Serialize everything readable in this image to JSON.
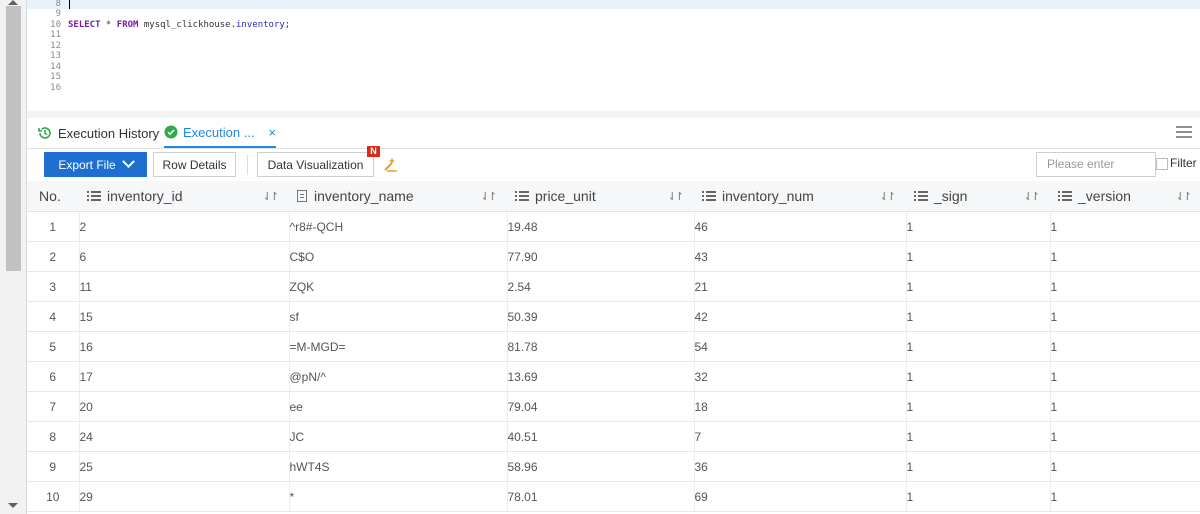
{
  "editor": {
    "lines": [
      {
        "n": "8",
        "code": ""
      },
      {
        "n": "9",
        "code": ""
      },
      {
        "n": "10",
        "kw1": "SELECT",
        "p1": " * ",
        "kw2": "FROM",
        "p2": " mysql_clickhouse.",
        "id": "inventory",
        "p3": ";"
      },
      {
        "n": "11"
      },
      {
        "n": "12"
      },
      {
        "n": "13"
      },
      {
        "n": "14"
      },
      {
        "n": "15"
      },
      {
        "n": "16"
      }
    ]
  },
  "tabs": {
    "history": "Execution History",
    "execution": "Execution ...",
    "close": "×"
  },
  "toolbar": {
    "export": "Export File",
    "row_details": "Row Details",
    "data_viz": "Data Visualization",
    "badge": "N",
    "search_placeholder": "Please enter",
    "filter": "Filter"
  },
  "table": {
    "headers": [
      "No.",
      "inventory_id",
      "inventory_name",
      "price_unit",
      "inventory_num",
      "_sign",
      "_version"
    ],
    "rows": [
      [
        "1",
        "2",
        "^r8#-QCH",
        "19.48",
        "46",
        "1",
        "1"
      ],
      [
        "2",
        "6",
        "C$O",
        "77.90",
        "43",
        "1",
        "1"
      ],
      [
        "3",
        "11",
        "ZQK",
        "2.54",
        "21",
        "1",
        "1"
      ],
      [
        "4",
        "15",
        "sf",
        "50.39",
        "42",
        "1",
        "1"
      ],
      [
        "5",
        "16",
        "=M-MGD=",
        "81.78",
        "54",
        "1",
        "1"
      ],
      [
        "6",
        "17",
        "@pN/^",
        "13.69",
        "32",
        "1",
        "1"
      ],
      [
        "7",
        "20",
        "ee",
        "79.04",
        "18",
        "1",
        "1"
      ],
      [
        "8",
        "24",
        "JC",
        "40.51",
        "7",
        "1",
        "1"
      ],
      [
        "9",
        "25",
        "hWT4S",
        "58.96",
        "36",
        "1",
        "1"
      ],
      [
        "10",
        "29",
        "*",
        "78.01",
        "69",
        "1",
        "1"
      ]
    ]
  },
  "colors": {
    "accent": "#1e88e5",
    "export_bg": "#1e6fd0",
    "badge": "#d62d20",
    "success": "#2eaa4f"
  }
}
